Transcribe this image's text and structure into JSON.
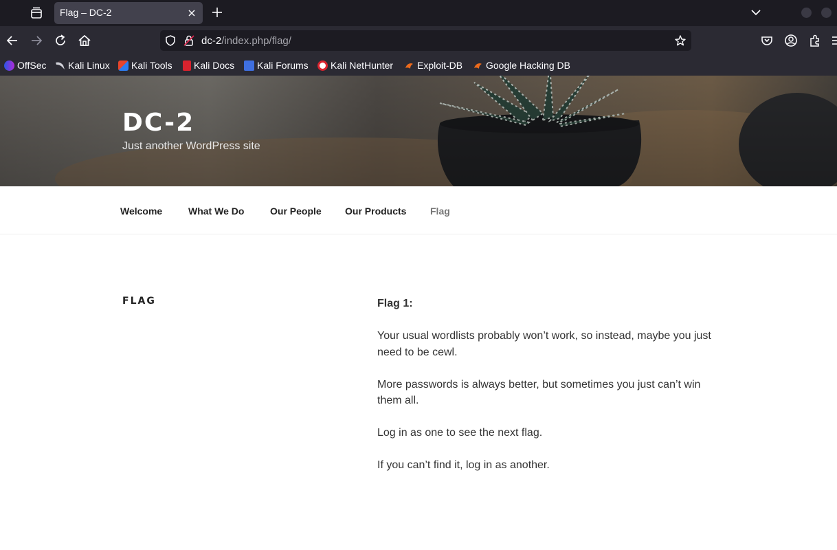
{
  "browser": {
    "tab": {
      "title": "Flag – DC-2"
    },
    "url": {
      "host": "dc-2",
      "path": "/index.php/flag/"
    },
    "bookmarks": [
      {
        "label": "OffSec",
        "icon": "offsec-icon"
      },
      {
        "label": "Kali Linux",
        "icon": "kali-dragon-icon"
      },
      {
        "label": "Kali Tools",
        "icon": "kali-tools-icon"
      },
      {
        "label": "Kali Docs",
        "icon": "kali-docs-icon"
      },
      {
        "label": "Kali Forums",
        "icon": "kali-forums-icon"
      },
      {
        "label": "Kali NetHunter",
        "icon": "nethunter-icon"
      },
      {
        "label": "Exploit-DB",
        "icon": "exploit-db-icon"
      },
      {
        "label": "Google Hacking DB",
        "icon": "ghdb-icon"
      }
    ]
  },
  "site": {
    "title": "DC-2",
    "description": "Just another WordPress site",
    "menu": [
      {
        "label": "Welcome"
      },
      {
        "label": "What We Do"
      },
      {
        "label": "Our People"
      },
      {
        "label": "Our Products"
      },
      {
        "label": "Flag"
      }
    ]
  },
  "page": {
    "title": "FLAG",
    "paragraphs": [
      "Flag 1:",
      "Your usual wordlists probably won’t work, so instead, maybe you just need to be cewl.",
      "More passwords is always better, but sometimes you just can’t win them all.",
      "Log in as one to see the next flag.",
      "If you can’t find it, log in as another."
    ]
  },
  "colors": {
    "chrome_dark": "#1c1b22",
    "chrome": "#2b2a33",
    "active_tab": "#42414d",
    "text_light": "#fbfbfe"
  }
}
